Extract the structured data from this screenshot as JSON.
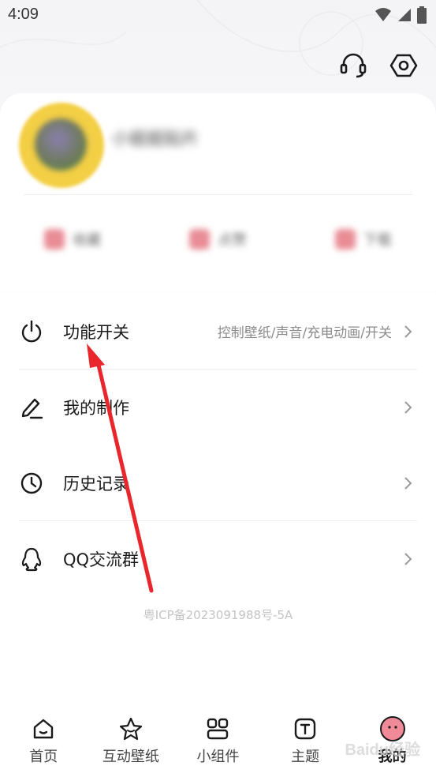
{
  "status_bar": {
    "time": "4:09"
  },
  "profile": {
    "username": "小姐姐贴片"
  },
  "stats": [
    {
      "label": "收藏"
    },
    {
      "label": "点赞"
    },
    {
      "label": "下载"
    }
  ],
  "menu": [
    {
      "label": "功能开关",
      "subtitle": "控制壁纸/声音/充电动画/开关",
      "icon": "power-icon"
    },
    {
      "label": "我的制作",
      "icon": "pencil-icon"
    },
    {
      "label": "历史记录",
      "icon": "clock-icon"
    },
    {
      "label": "QQ交流群",
      "icon": "qq-penguin-icon"
    }
  ],
  "icp": "粤ICP备2023091988号-5A",
  "tabs": [
    {
      "label": "首页",
      "icon": "home-icon"
    },
    {
      "label": "互动壁纸",
      "icon": "star-icon"
    },
    {
      "label": "小组件",
      "icon": "widgets-icon"
    },
    {
      "label": "主题",
      "icon": "theme-t-icon"
    },
    {
      "label": "我的",
      "icon": "mine-face-icon",
      "active": true
    }
  ],
  "watermark": "Baidu经验",
  "colors": {
    "arrow": "#e8262b",
    "avatar": "#f3cf45",
    "mine_tab": "#f08a98"
  }
}
